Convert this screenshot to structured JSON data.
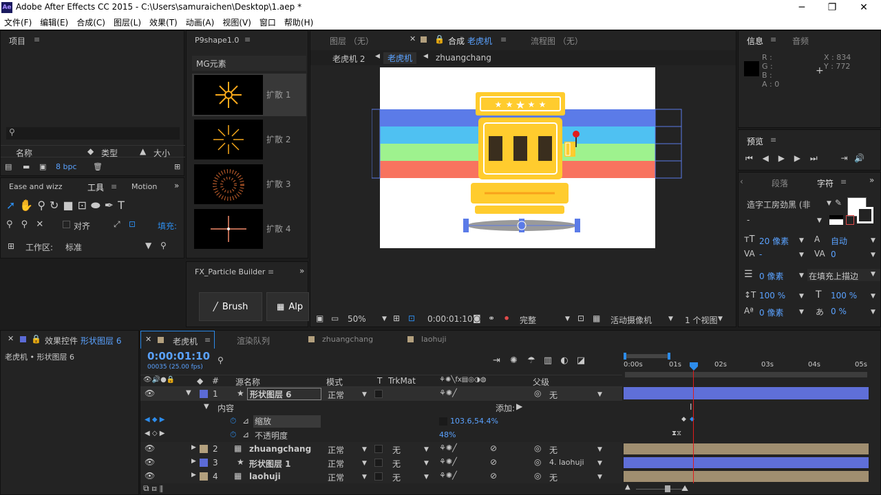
{
  "app": {
    "title": "Adobe After Effects CC 2015 - C:\\Users\\samuraichen\\Desktop\\1.aep *",
    "logo": "Ae"
  },
  "window_controls": {
    "minimize": "─",
    "restore": "❐",
    "close": "✕"
  },
  "menu": [
    "文件(F)",
    "编辑(E)",
    "合成(C)",
    "图层(L)",
    "效果(T)",
    "动画(A)",
    "视图(V)",
    "窗口",
    "帮助(H)"
  ],
  "project": {
    "tab": "项目",
    "col_name": "名称",
    "col_type": "类型",
    "col_size": "大小",
    "bpc": "8 bpc"
  },
  "tools": {
    "tab1": "Ease and wizz",
    "tab2": "工具",
    "tab3": "Motion",
    "align_label": "对齐",
    "fill_label": "填充:",
    "workspace_label": "工作区:",
    "workspace_value": "标准"
  },
  "p9": {
    "tab": "P9shape1.0",
    "category": "MG元素",
    "items": [
      "扩散 1",
      "扩散 2",
      "扩散 3",
      "扩散 4"
    ]
  },
  "fx": {
    "tab": "FX_Particle Builder",
    "brush": "Brush",
    "alpha": "Alp"
  },
  "viewer": {
    "tab_layer": "图层 （无）",
    "tab_comp_prefix": "合成",
    "tab_comp_name": "老虎机",
    "tab_flow": "流程图 （无）",
    "crumb1": "老虎机 2",
    "crumb2": "老虎机",
    "crumb3": "zhuangchang",
    "zoom": "50%",
    "timecode": "0:00:01:10",
    "quality": "完整",
    "camera": "活动摄像机",
    "views": "1 个视图"
  },
  "info": {
    "tab": "信息",
    "tab2": "音频",
    "r": "R :",
    "g": "G :",
    "b": "B :",
    "a": "A : 0",
    "x": "X : 834",
    "y": "Y : 772"
  },
  "preview": {
    "tab": "预览"
  },
  "character": {
    "tab_para": "段落",
    "tab_char": "字符",
    "font": "造字工房劲黑 (非",
    "style": "-",
    "size": "20 像素",
    "leading": "自动",
    "kerning": "-",
    "tracking": "0",
    "stroke": "0 像素",
    "stroke_mode": "在填充上描边",
    "vscale": "100 %",
    "hscale": "100 %",
    "baseline": "0 像素",
    "tsume": "0 %"
  },
  "effects": {
    "tab_prefix": "效果控件",
    "tab_layer": "形状图层 6",
    "breadcrumb": "老虎机 • 形状图层 6"
  },
  "timeline": {
    "tab": "老虎机",
    "tab_render": "渲染队列",
    "tab_zc": "zhuangchang",
    "tab_lhj": "laohuji",
    "timecode": "0:00:01:10",
    "fps": "00035 (25.00 fps)",
    "headers": {
      "num": "#",
      "source": "源名称",
      "mode": "模式",
      "t": "T",
      "trkmat": "TrkMat",
      "parent": "父级"
    },
    "ruler": [
      "0:00s",
      "01s",
      "02s",
      "03s",
      "04s",
      "05s"
    ],
    "layers": [
      {
        "num": "1",
        "name": "形状图层 6",
        "mode": "正常",
        "trk": "",
        "parent": "无",
        "color": "#5b6bd6"
      },
      {
        "num": "2",
        "name": "zhuangchang",
        "mode": "正常",
        "trk": "无",
        "parent": "无",
        "color": "#b3a07e"
      },
      {
        "num": "3",
        "name": "形状图层 1",
        "mode": "正常",
        "trk": "无",
        "parent": "4. laohuji",
        "color": "#5b6bd6"
      },
      {
        "num": "4",
        "name": "laohuji",
        "mode": "正常",
        "trk": "无",
        "parent": "无",
        "color": "#b3a07e"
      }
    ],
    "content": "内容",
    "add": "添加:",
    "scale_label": "缩放",
    "scale_value": "103.6,54.4%",
    "opacity_label": "不透明度",
    "opacity_value": "48%"
  }
}
